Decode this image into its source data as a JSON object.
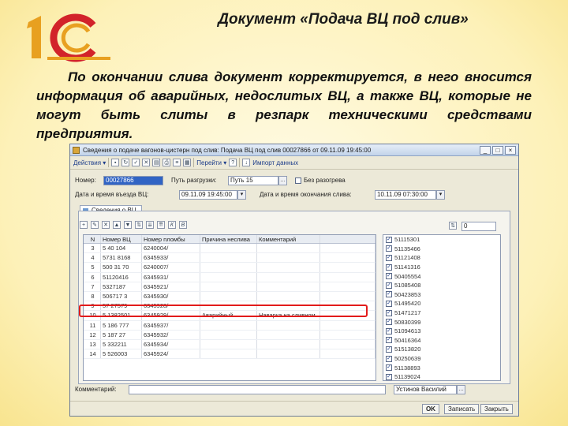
{
  "logo": {
    "text": "1С",
    "colors": {
      "orange": "#e8a020",
      "red": "#d2232a"
    }
  },
  "title": "Документ «Подача ВЦ под слив»",
  "description": "По окончании слива документ корректируется, в него вносится информация об аварийных, недослитых ВЦ, а также ВЦ, которые не могут быть слиты в резпарк техническими средствами предприятия.",
  "window": {
    "title": "Сведения о подаче вагонов-цистерн под слив: Подача ВЦ под слив 00027866 от 09.11.09 19:45:00",
    "buttons": {
      "minimize": "_",
      "maximize": "□",
      "close": "×"
    },
    "toolbar": {
      "actions": "Действия ▾",
      "goto": "Перейти ▾",
      "import": "Импорт данных"
    },
    "form": {
      "number_label": "Номер:",
      "number_value": "00027866",
      "route_label": "Путь разгрузки:",
      "route_value": "Путь 15",
      "arrival_label": "Дата и время въезда ВЦ:",
      "arrival_value": "09.11.09 19:45:00",
      "end_label": "Дата и время окончания слива:",
      "end_value": "10.11.09 07:30:00",
      "heater_label": "Без разогрева"
    },
    "tab_label": "Сведения о ВЦ",
    "left_toolbar_icons": [
      "+",
      "✎",
      "✕",
      "▲",
      "▼",
      "⇅",
      "⇊",
      "⇈",
      "К",
      "В"
    ],
    "grid": {
      "columns": [
        "N",
        "Номер ВЦ",
        "Номер пломбы",
        "Причина неслива",
        "Комментарий"
      ],
      "rows": [
        {
          "n": "3",
          "num": "5 40 104",
          "seal": "6240004/",
          "reason": "",
          "comment": ""
        },
        {
          "n": "4",
          "num": "5731 8168",
          "seal": "6345933/",
          "reason": "",
          "comment": ""
        },
        {
          "n": "5",
          "num": "500 31 70",
          "seal": "6240007/",
          "reason": "",
          "comment": ""
        },
        {
          "n": "6",
          "num": "51120416",
          "seal": "6345931/",
          "reason": "",
          "comment": ""
        },
        {
          "n": "7",
          "num": "5327187",
          "seal": "6345921/",
          "reason": "",
          "comment": ""
        },
        {
          "n": "8",
          "num": "506717 3",
          "seal": "6345930/",
          "reason": "",
          "comment": ""
        },
        {
          "n": "9",
          "num": "57 27579",
          "seal": "6345928/",
          "reason": "",
          "comment": ""
        },
        {
          "n": "10",
          "num": "5 1382501",
          "seal": "6345929/",
          "reason": "Аварийный",
          "comment": "Наварка на сливном"
        },
        {
          "n": "11",
          "num": "5 186 777",
          "seal": "6345937/",
          "reason": "",
          "comment": ""
        },
        {
          "n": "12",
          "num": "5 187 27",
          "seal": "6345932/",
          "reason": "",
          "comment": ""
        },
        {
          "n": "13",
          "num": "5 332211",
          "seal": "6345934/",
          "reason": "",
          "comment": ""
        },
        {
          "n": "14",
          "num": "5 526003",
          "seal": "6345924/",
          "reason": "",
          "comment": ""
        }
      ]
    },
    "right_list": {
      "search_value": "0",
      "items": [
        "51115301",
        "51135466",
        "51121408",
        "51141316",
        "50405554",
        "51085408",
        "50423853",
        "51495420",
        "51471217",
        "50830399",
        "51094613",
        "50416364",
        "51513820",
        "50250639",
        "51138893",
        "51139024"
      ]
    },
    "comment_label": "Комментарий:",
    "comment_value": "",
    "responsible_value": "Устинов Василий",
    "bottom_buttons": {
      "ok": "OK",
      "save": "Записать",
      "close": "Закрыть"
    }
  }
}
